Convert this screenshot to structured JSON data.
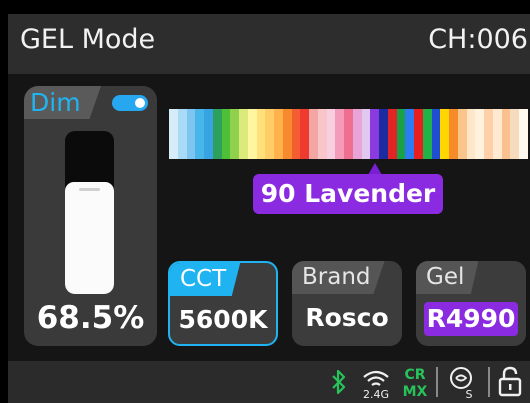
{
  "header": {
    "title": "GEL Mode",
    "channel": "CH:006"
  },
  "dimmer": {
    "label": "Dim",
    "toggle_on": true,
    "value_text": "68.5%",
    "level": 0.685
  },
  "gel_strip": {
    "colors": [
      "#d6ecf9",
      "#a9dbf6",
      "#7ec6f1",
      "#49b6ea",
      "#38a3e2",
      "#2ea05e",
      "#4fbf3a",
      "#8fd14a",
      "#dcea7b",
      "#fff7a0",
      "#ffe07a",
      "#ffcd68",
      "#ffb14c",
      "#f68a2d",
      "#f45d32",
      "#ef3b2f",
      "#f3a6a4",
      "#f8c6c8",
      "#f7cfe1",
      "#f39bb8",
      "#ef6f91",
      "#e8a4d6",
      "#e0c8ef",
      "#8a3be0",
      "#1c2ca0",
      "#e32424",
      "#19a148",
      "#2d7df2",
      "#e81f1f",
      "#22b24a",
      "#1f4fd0",
      "#ffd600",
      "#f78b2a",
      "#f9c58a",
      "#fde7c8",
      "#fff3e0",
      "#ffd0a8",
      "#ffe9d0",
      "#fbc08f",
      "#f7dbbf",
      "#fff8ee"
    ],
    "selected_index": 23,
    "selected_name": "90 Lavender"
  },
  "cards": {
    "cct": {
      "label": "CCT",
      "value": "5600K"
    },
    "brand": {
      "label": "Brand",
      "value": "Rosco"
    },
    "gel": {
      "label": "Gel",
      "value": "R4990"
    }
  },
  "statusbar": {
    "wireless_band_text": "2.4G",
    "crmx_text": [
      "CR",
      "MX"
    ],
    "s_text": "S",
    "colors": {
      "bluetooth": "#27c25a",
      "crmx": "#27c25a",
      "icons": "#f0f0f0"
    }
  },
  "colors": {
    "accent_blue": "#1fb4f1",
    "accent_purple": "#8a2be2"
  }
}
